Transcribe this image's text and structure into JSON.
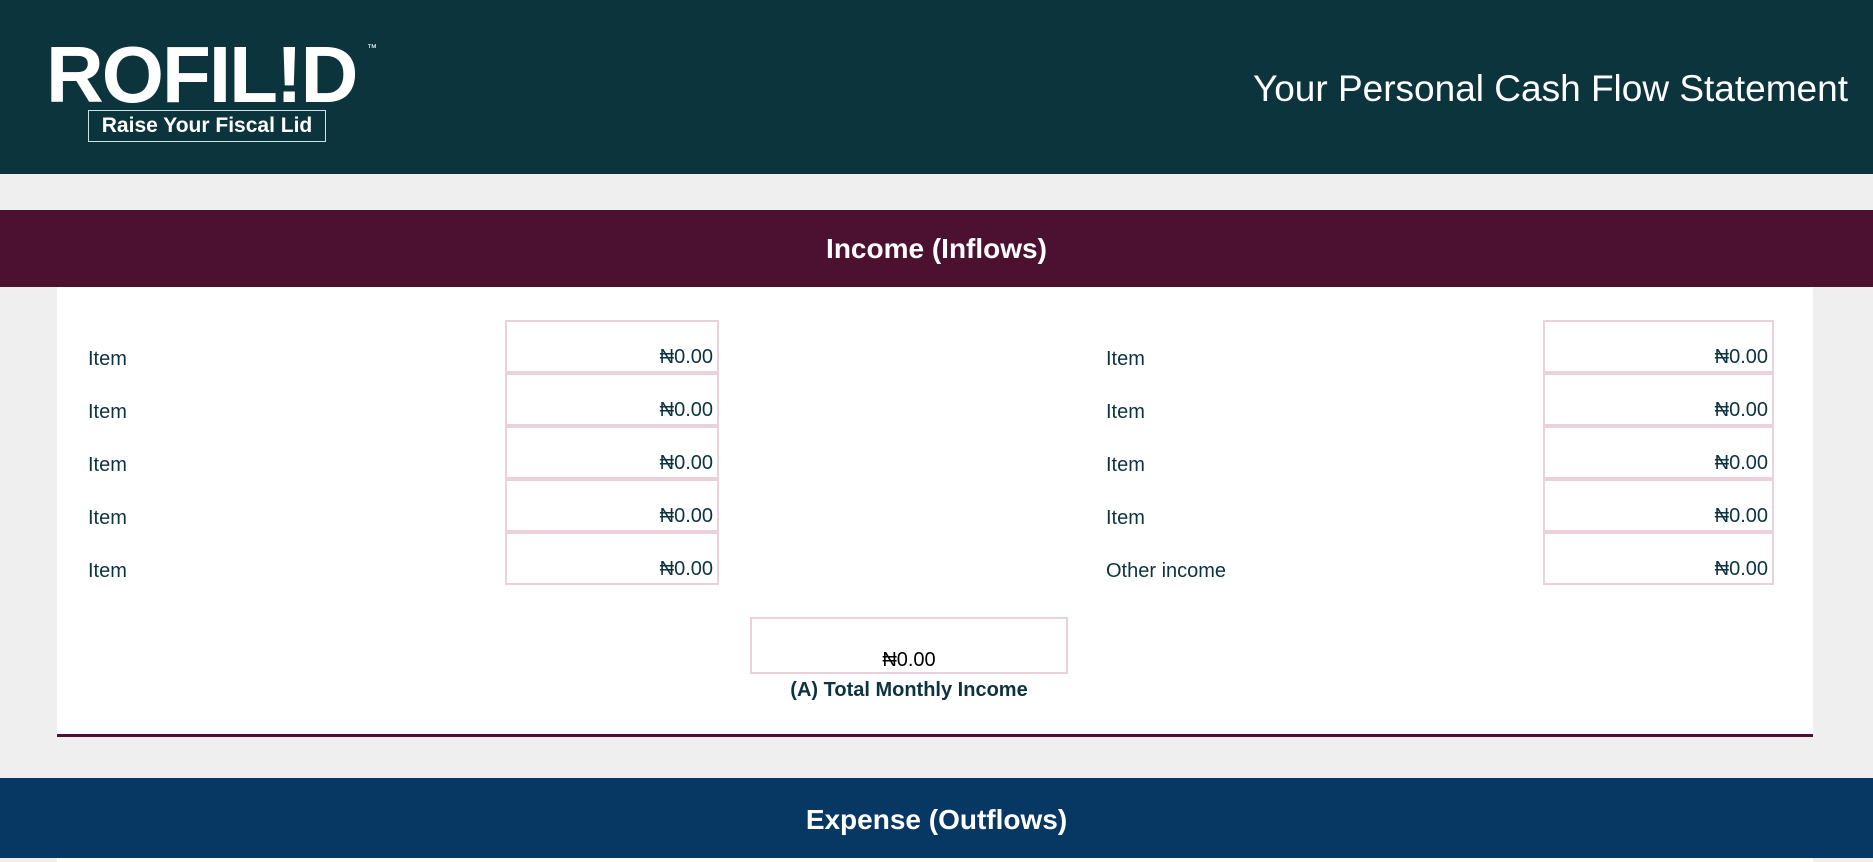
{
  "header": {
    "logo_text": "ROFIL!D",
    "logo_tm": "™",
    "tagline": "Raise Your Fiscal Lid",
    "page_title": "Your Personal Cash Flow Statement"
  },
  "colors": {
    "header_bg": "#0c343d",
    "income_bar": "#4c1130",
    "expense_bar": "#073763",
    "field_border": "#ead1dc",
    "text": "#0d3340"
  },
  "income": {
    "section_title": "Income (Inflows)",
    "left_items": [
      {
        "label": "Item",
        "amount": "₦0.00"
      },
      {
        "label": "Item",
        "amount": "₦0.00"
      },
      {
        "label": "Item",
        "amount": "₦0.00"
      },
      {
        "label": "Item",
        "amount": "₦0.00"
      },
      {
        "label": "Item",
        "amount": "₦0.00"
      }
    ],
    "right_items": [
      {
        "label": "Item",
        "amount": "₦0.00"
      },
      {
        "label": "Item",
        "amount": "₦0.00"
      },
      {
        "label": "Item",
        "amount": "₦0.00"
      },
      {
        "label": "Item",
        "amount": "₦0.00"
      },
      {
        "label": "Other income",
        "amount": "₦0.00"
      }
    ],
    "total_value": "₦0.00",
    "total_label": "(A) Total Monthly Income"
  },
  "expense": {
    "section_title": "Expense (Outflows)"
  }
}
